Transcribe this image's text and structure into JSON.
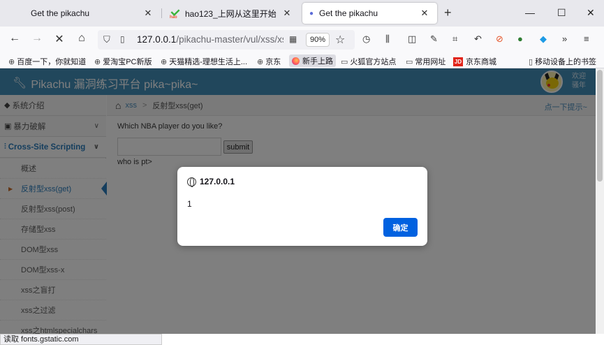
{
  "browser": {
    "tabs": [
      {
        "title": "Get the pikachu",
        "close": "✕"
      },
      {
        "title": "hao123_上网从这里开始",
        "close": "✕"
      },
      {
        "title": "Get the pikachu",
        "close": "✕"
      }
    ],
    "new_tab": "+",
    "window_controls": {
      "minimize": "—",
      "maximize": "☐",
      "close": "✕"
    },
    "url_host": "127.0.0.1",
    "url_path": "/pikachu-master/vul/xss/xss_reflected_get.php",
    "zoom": "90%",
    "bookmarks": [
      "百度一下，你就知道",
      "爱淘宝PC新版",
      "天猫精选-理想生活上...",
      "京东",
      "新手上路",
      "火狐官方站点",
      "常用网址",
      "京东商城",
      "移动设备上的书签"
    ],
    "status_text": "读取 fonts.gstatic.com"
  },
  "app": {
    "title": "Pikachu 漏洞练习平台 pika~pika~",
    "welcome_line1": "欢迎",
    "welcome_line2": "骚年"
  },
  "sidebar": {
    "items": [
      {
        "label": "系统介绍"
      },
      {
        "label": "暴力破解"
      },
      {
        "label": "Cross-Site Scripting"
      }
    ],
    "sub_items": [
      "概述",
      "反射型xss(get)",
      "反射型xss(post)",
      "存储型xss",
      "DOM型xss",
      "DOM型xss-x",
      "xss之盲打",
      "xss之过滤",
      "xss之htmlspecialchars"
    ]
  },
  "breadcrumb": {
    "link": "xss",
    "separator": ">",
    "current": "反射型xss(get)",
    "hint": "点一下提示~"
  },
  "content": {
    "question": "Which NBA player do you like?",
    "input_value": "",
    "submit_label": "submit",
    "result": "who is pt>"
  },
  "dialog": {
    "origin": "127.0.0.1",
    "message": "1",
    "ok_label": "确定"
  },
  "colors": {
    "header_blue": "#438eb9",
    "link_blue": "#2b7dbc",
    "dialog_button": "#0061e0"
  }
}
